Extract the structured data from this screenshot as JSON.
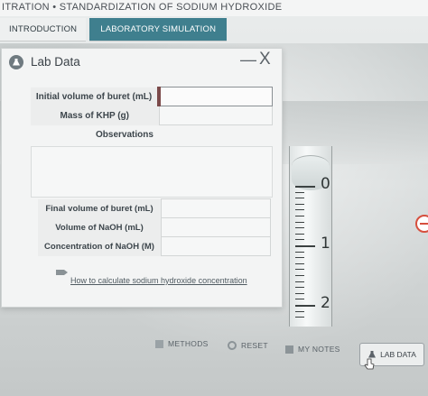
{
  "header": {
    "title": "ITRATION • STANDARDIZATION OF SODIUM HYDROXIDE"
  },
  "tabs": [
    {
      "label": "INTRODUCTION",
      "active": false
    },
    {
      "label": "LABORATORY SIMULATION",
      "active": true
    }
  ],
  "lab_data": {
    "title": "Lab Data",
    "minimize_label": "—",
    "close_label": "X",
    "fields": [
      {
        "label": "Initial volume of buret (mL)",
        "value": ""
      },
      {
        "label": "Mass of KHP (g)",
        "value": ""
      }
    ],
    "observations_label": "Observations",
    "observations_value": "",
    "fields2": [
      {
        "label": "Final volume of buret (mL)",
        "value": ""
      },
      {
        "label": "Volume of NaOH (mL)",
        "value": ""
      },
      {
        "label": "Concentration of NaOH (M)",
        "value": ""
      }
    ],
    "help_link": "How to calculate sodium hydroxide concentration"
  },
  "burette": {
    "labels": [
      "0",
      "1",
      "2"
    ]
  },
  "toolbar": {
    "methods": "METHODS",
    "reset": "RESET",
    "my_notes": "MY NOTES",
    "lab_data": "LAB DATA"
  },
  "colors": {
    "accent": "#3f7f8e",
    "alert": "#d64f3e"
  }
}
